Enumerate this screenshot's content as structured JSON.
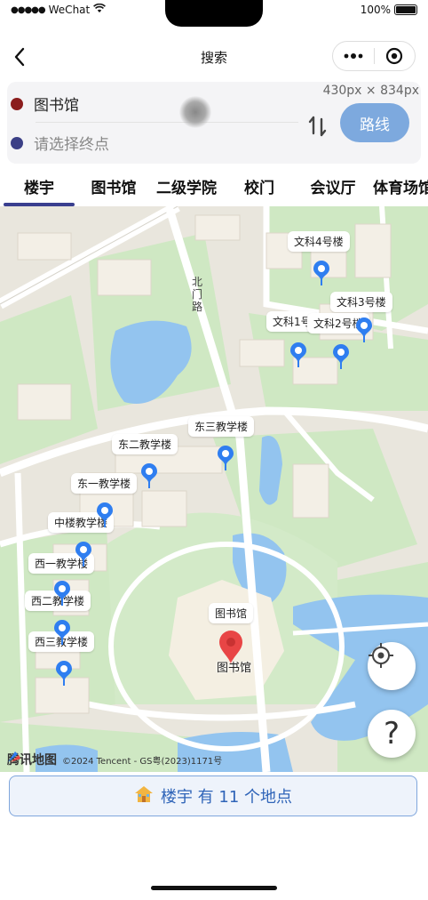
{
  "status": {
    "carrier": "WeChat",
    "battery": "100%"
  },
  "nav": {
    "title": "搜索"
  },
  "dims_overlay": "430px × 834px",
  "route": {
    "start_value": "图书馆",
    "end_placeholder": "请选择终点",
    "route_button": "路线",
    "start_color": "#8b1d1d",
    "end_color": "#3b3f86",
    "button_color": "#7da9de"
  },
  "tabs": [
    {
      "label": "楼宇",
      "active": true
    },
    {
      "label": "图书馆",
      "active": false
    },
    {
      "label": "二级学院",
      "active": false
    },
    {
      "label": "校门",
      "active": false
    },
    {
      "label": "会议厅",
      "active": false
    },
    {
      "label": "体育场馆",
      "active": false
    }
  ],
  "map": {
    "road_label": "北门路",
    "markers": [
      {
        "label": "文科4号楼"
      },
      {
        "label": "文科3号楼"
      },
      {
        "label": "文科1号"
      },
      {
        "label": "文科2号楼"
      },
      {
        "label": "东三教学楼"
      },
      {
        "label": "东二教学楼"
      },
      {
        "label": "东一教学楼"
      },
      {
        "label": "中楼教学楼"
      },
      {
        "label": "西一教学楼"
      },
      {
        "label": "西二教学楼"
      },
      {
        "label": "西三教学楼"
      },
      {
        "label": "图书馆"
      }
    ],
    "selected_marker_label": "图书馆",
    "attribution_brand": "腾讯地图",
    "attribution_text": "©2024 Tencent - GS粤(2023)1171号",
    "pin_color": "#2f7ef0",
    "selected_pin_color": "#e84545"
  },
  "summary": {
    "text": "楼宇 有 11 个地点"
  }
}
